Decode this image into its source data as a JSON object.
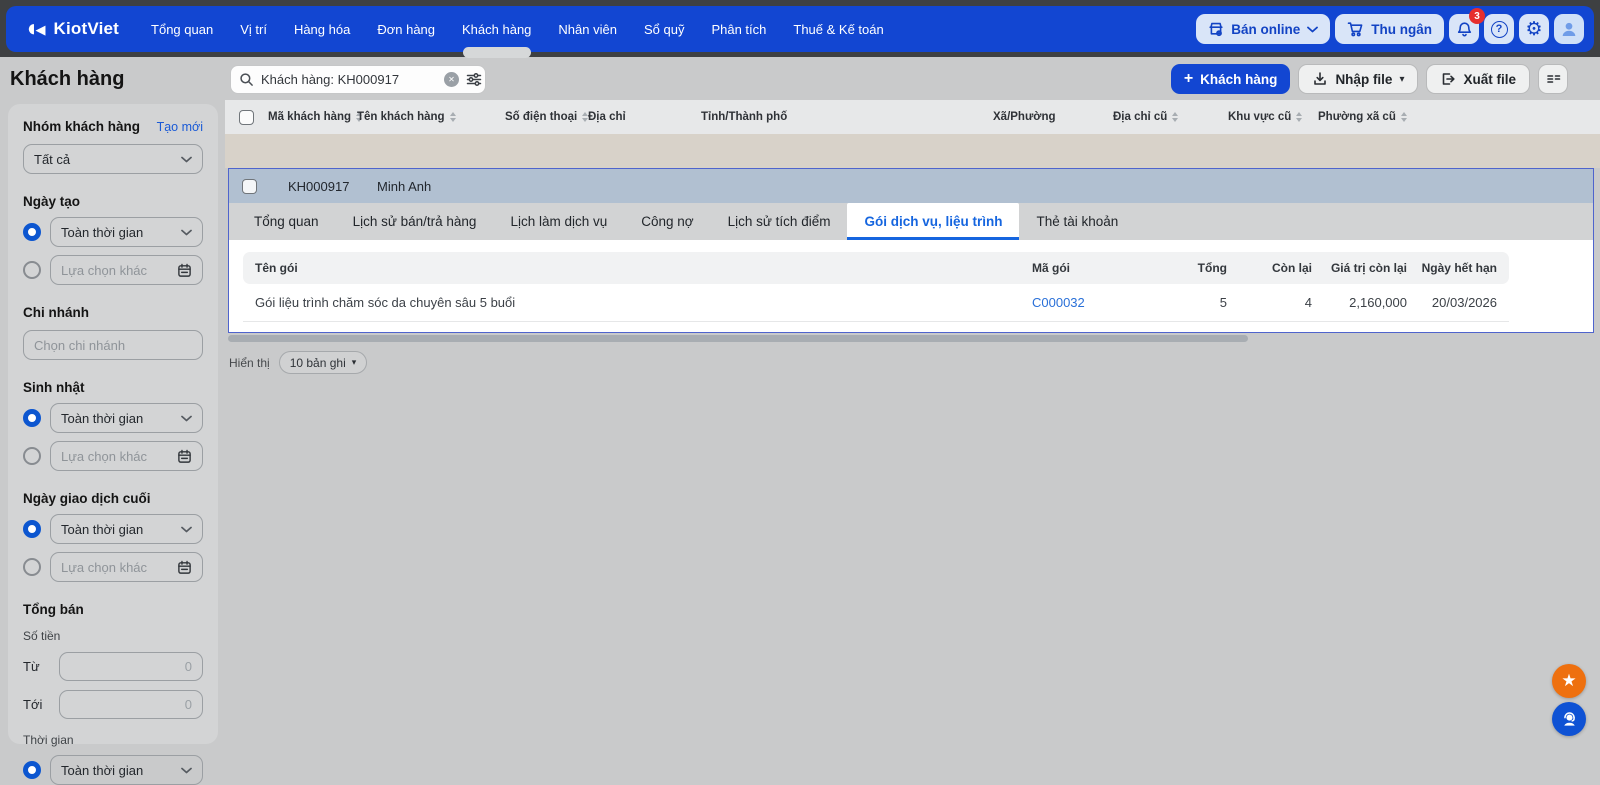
{
  "colors": {
    "nav_blue": "#1246d2",
    "nav_pill_bg": "#d9e5f8",
    "badge_red": "#e62e2e",
    "page_bg": "#c9cacb",
    "panel_border": "#4f64cd",
    "selected_row_bg": "#b1c0d1",
    "active_tab_blue": "#1565df",
    "link_blue": "#2a70d8",
    "float_orange": "#ee700f",
    "float_blue": "#0f52d4"
  },
  "nav": {
    "brand": "KiotViet",
    "items": [
      "Tổng quan",
      "Vị trí",
      "Hàng hóa",
      "Đơn hàng",
      "Khách hàng",
      "Nhân viên",
      "Sổ quỹ",
      "Phân tích",
      "Thuế & Kế toán"
    ],
    "active_item": "Khách hàng",
    "online_button": "Bán online",
    "cashier_button": "Thu ngân",
    "notification_count": "3"
  },
  "header": {
    "title": "Khách hàng",
    "search_value": "Khách hàng: KH000917",
    "add_customer_button": "Khách hàng",
    "import_button": "Nhập file",
    "export_button": "Xuất file"
  },
  "sidebar": {
    "customer_group": {
      "label": "Nhóm khách hàng",
      "create_link": "Tạo mới",
      "value": "Tất cả"
    },
    "created_date": {
      "label": "Ngày tạo",
      "all_time": "Toàn thời gian",
      "other": "Lựa chọn khác"
    },
    "branch": {
      "label": "Chi nhánh",
      "placeholder": "Chọn chi nhánh"
    },
    "birthday": {
      "label": "Sinh nhật",
      "all_time": "Toàn thời gian",
      "other": "Lựa chọn khác"
    },
    "last_transaction": {
      "label": "Ngày giao dịch cuối",
      "all_time": "Toàn thời gian",
      "other": "Lựa chọn khác"
    },
    "total_sales": {
      "label": "Tổng bán",
      "amount_label": "Số tiền",
      "from_label": "Từ",
      "from_value": "0",
      "to_label": "Tới",
      "to_value": "0",
      "time_label": "Thời gian",
      "all_time": "Toàn thời gian"
    }
  },
  "table": {
    "columns": [
      {
        "label": "Mã khách hàng",
        "sortable": true
      },
      {
        "label": "Tên khách hàng",
        "sortable": true
      },
      {
        "label": "Số điện thoại",
        "sortable": true
      },
      {
        "label": "Địa chỉ",
        "sortable": false
      },
      {
        "label": "Tỉnh/Thành phố",
        "sortable": false
      },
      {
        "label": "Xã/Phường",
        "sortable": false
      },
      {
        "label": "Địa chỉ cũ",
        "sortable": true
      },
      {
        "label": "Khu vực cũ",
        "sortable": true
      },
      {
        "label": "Phường xã cũ",
        "sortable": true
      }
    ]
  },
  "customer": {
    "code": "KH000917",
    "name": "Minh Anh"
  },
  "detail_tabs": [
    "Tổng quan",
    "Lịch sử bán/trả hàng",
    "Lịch làm dịch vụ",
    "Công nợ",
    "Lịch sử tích điểm",
    "Gói dịch vụ, liệu trình",
    "Thẻ tài khoản"
  ],
  "active_tab": "Gói dịch vụ, liệu trình",
  "packages": {
    "columns": [
      "Tên gói",
      "Mã gói",
      "Tổng",
      "Còn lại",
      "Giá trị còn lại",
      "Ngày hết hạn"
    ],
    "rows": [
      {
        "name": "Gói liệu trình chăm sóc da chuyên sâu 5 buổi",
        "code": "C000032",
        "total": "5",
        "remaining": "4",
        "remaining_value": "2,160,000",
        "expiry": "20/03/2026"
      }
    ]
  },
  "pagination": {
    "show_label": "Hiển thị",
    "page_size": "10 bản ghi"
  }
}
